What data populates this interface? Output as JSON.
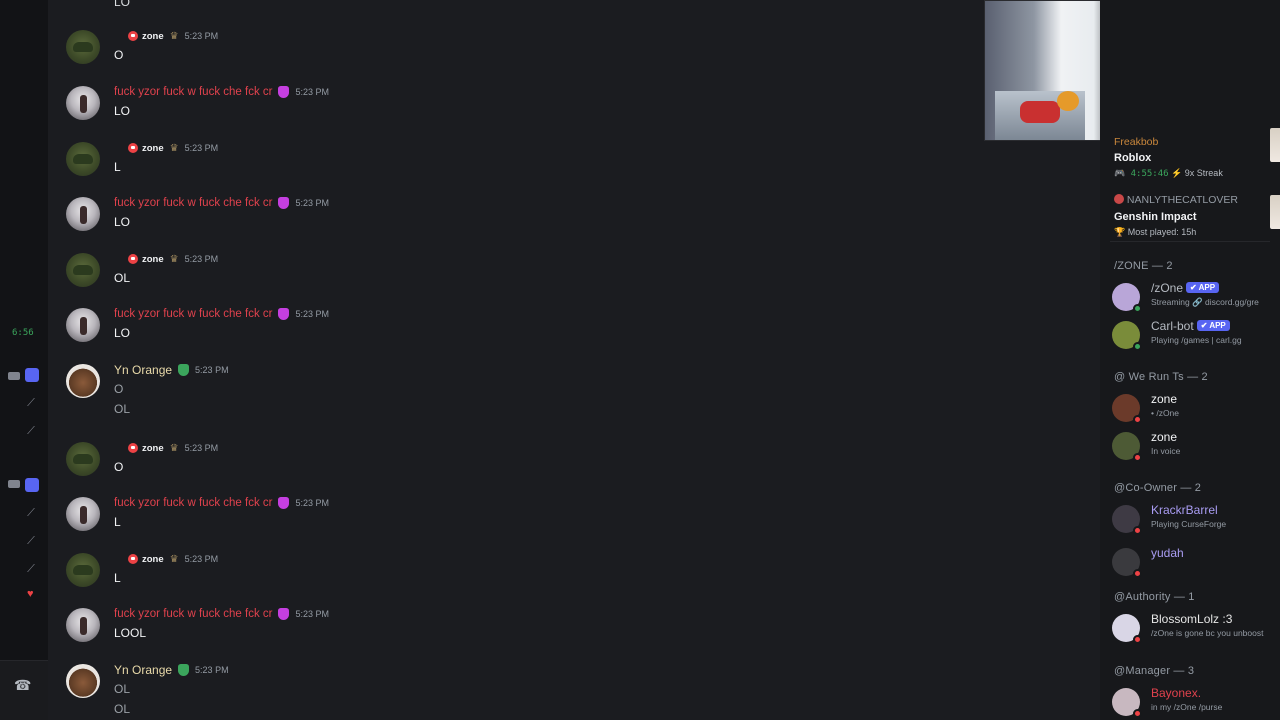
{
  "rail": {
    "clock": "6:56"
  },
  "chat": {
    "top_fragment": "LO",
    "messages": [
      {
        "author": "zone",
        "kind": "zone",
        "time": "5:23 PM",
        "lines": [
          "O"
        ]
      },
      {
        "author": "fuck yzor fuck w fuck che fck cr",
        "kind": "fuck",
        "time": "5:23 PM",
        "lines": [
          "LO"
        ]
      },
      {
        "author": "zone",
        "kind": "zone",
        "time": "5:23 PM",
        "lines": [
          "L"
        ]
      },
      {
        "author": "fuck yzor fuck w fuck che fck cr",
        "kind": "fuck",
        "time": "5:23 PM",
        "lines": [
          "LO"
        ]
      },
      {
        "author": "zone",
        "kind": "zone",
        "time": "5:23 PM",
        "lines": [
          "OL"
        ]
      },
      {
        "author": "fuck yzor fuck w fuck che fck cr",
        "kind": "fuck",
        "time": "5:23 PM",
        "lines": [
          "LO"
        ]
      },
      {
        "author": "Yn Orange",
        "kind": "yn",
        "time": "5:23 PM",
        "lines": [
          "O",
          "OL"
        ]
      },
      {
        "author": "zone",
        "kind": "zone",
        "time": "5:23 PM",
        "lines": [
          "O"
        ]
      },
      {
        "author": "fuck yzor fuck w fuck che fck cr",
        "kind": "fuck",
        "time": "5:23 PM",
        "lines": [
          "L"
        ]
      },
      {
        "author": "zone",
        "kind": "zone",
        "time": "5:23 PM",
        "lines": [
          "L"
        ]
      },
      {
        "author": "fuck yzor fuck w fuck che fck cr",
        "kind": "fuck",
        "time": "5:23 PM",
        "lines": [
          "LOOL"
        ]
      },
      {
        "author": "Yn Orange",
        "kind": "yn",
        "time": "5:23 PM",
        "lines": [
          "OL",
          "OL"
        ]
      }
    ]
  },
  "activity": {
    "roblox": {
      "user": "Freakbob",
      "game": "Roblox",
      "time": "4:55:46",
      "streak": "9x Streak"
    },
    "genshin": {
      "user": "NANLYTHECATLOVER",
      "game": "Genshin Impact",
      "detail": "Most played: 15h"
    }
  },
  "members": {
    "groups": [
      {
        "title": "/ZONE — 2",
        "items": [
          {
            "name": "/zOne",
            "app": "APP",
            "sub": "Streaming 🔗 discord.gg/gre",
            "color": "#b5bac1"
          },
          {
            "name": "Carl-bot",
            "app": "APP",
            "sub": "Playing /games | carl.gg",
            "color": "#b5bac1"
          }
        ]
      },
      {
        "title": "@ We Run Ts — 2",
        "items": [
          {
            "name": "zone",
            "sub": "• /zOne",
            "color": "#f2f3f5"
          },
          {
            "name": "zone",
            "sub": "In voice",
            "color": "#f2f3f5"
          }
        ]
      },
      {
        "title": "@Co-Owner — 2",
        "items": [
          {
            "name": "KrackrBarrel",
            "sub": "Playing CurseForge",
            "color": "#a99cf2"
          },
          {
            "name": "yudah",
            "sub": "",
            "color": "#a99cf2"
          }
        ]
      },
      {
        "title": "@Authority — 1",
        "items": [
          {
            "name": "BlossomLolz :3",
            "sub": "/zOne is gone bc you unboost",
            "color": "#e6e6e6"
          }
        ]
      },
      {
        "title": "@Manager — 3",
        "items": [
          {
            "name": "Bayonex.",
            "sub": "in my /zOne /purse",
            "color": "#e0424d"
          }
        ]
      }
    ]
  },
  "colors": {
    "accent": "#5865f2",
    "online": "#3ba55c",
    "dnd": "#ed4245",
    "role_red": "#e0424d"
  }
}
